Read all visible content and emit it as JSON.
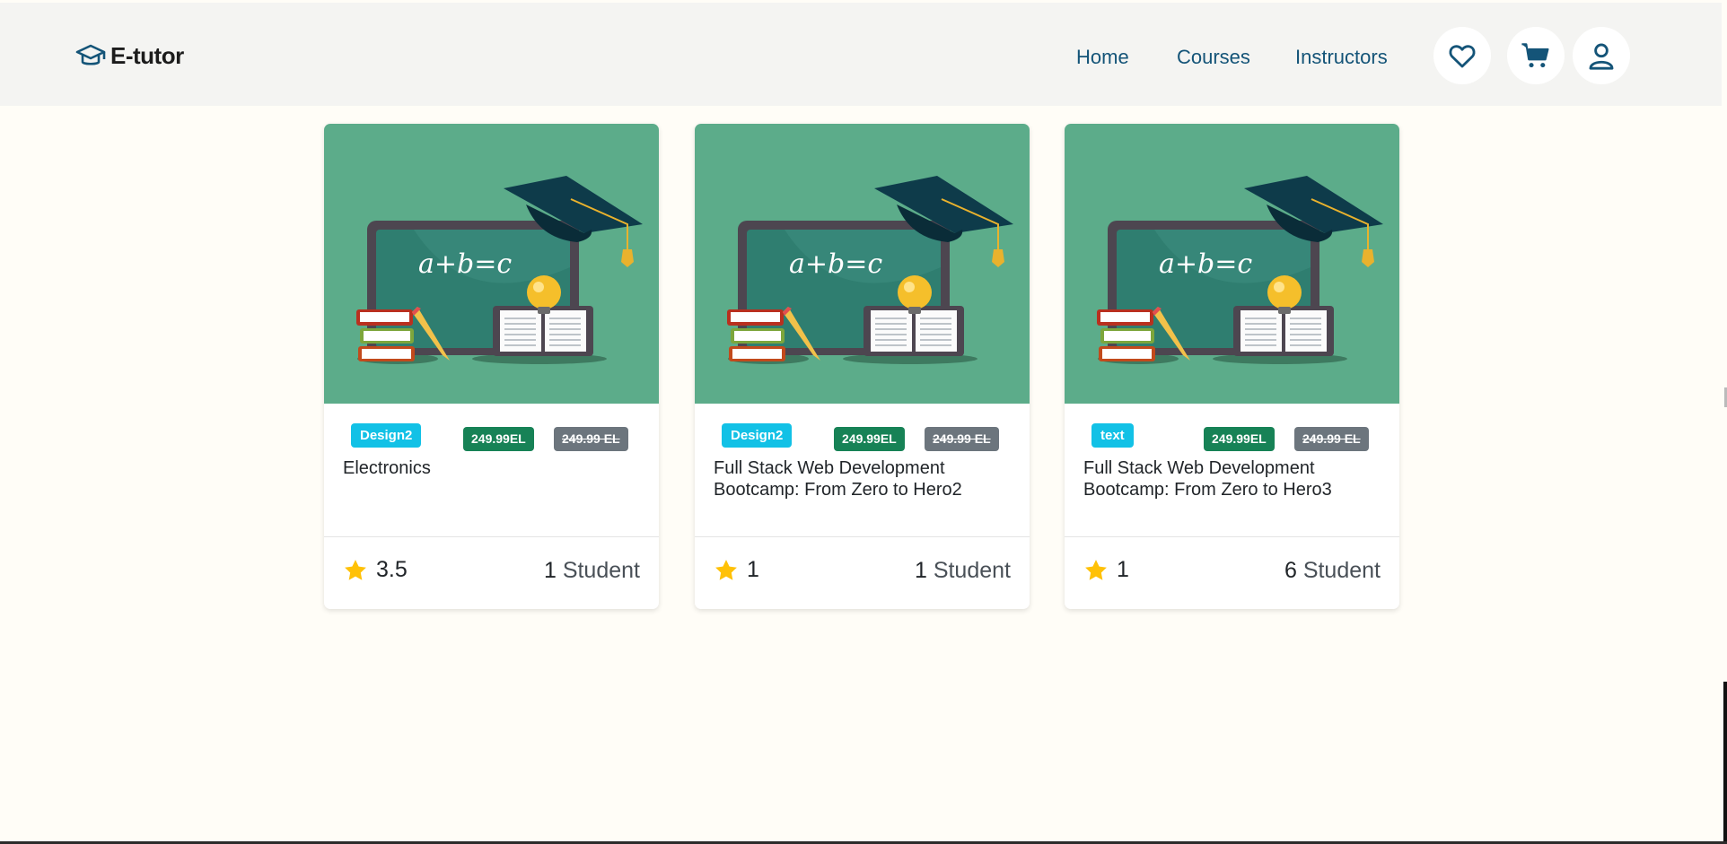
{
  "brand": {
    "name": "E-tutor",
    "color": "#145478"
  },
  "nav": {
    "items": [
      "Home",
      "Courses",
      "Instructors"
    ]
  },
  "header_icons": [
    "heart-icon",
    "cart-icon",
    "user-icon"
  ],
  "cards": [
    {
      "category": "Design2",
      "price": "249.99EL",
      "old_price": "249.99 EL",
      "title": "Electronics",
      "image_text": "a+b=c",
      "rating": "3.5",
      "students_count": "1",
      "students_label": "Student"
    },
    {
      "category": "Design2",
      "price": "249.99EL",
      "old_price": "249.99 EL",
      "title": "Full Stack Web Development Bootcamp: From Zero to Hero2",
      "image_text": "a+b=c",
      "rating": "1",
      "students_count": "1",
      "students_label": "Student"
    },
    {
      "category": "text",
      "price": "249.99EL",
      "old_price": "249.99 EL",
      "title": "Full Stack Web Development Bootcamp: From Zero to Hero3",
      "image_text": "a+b=c",
      "rating": "1",
      "students_count": "6",
      "students_label": "Student"
    }
  ],
  "colors": {
    "category_badge": "#12c1e6",
    "price_badge": "#178256",
    "old_price_badge": "#6c757d",
    "star": "#ffc107",
    "thumbnail_bg": "#5cac8a"
  }
}
